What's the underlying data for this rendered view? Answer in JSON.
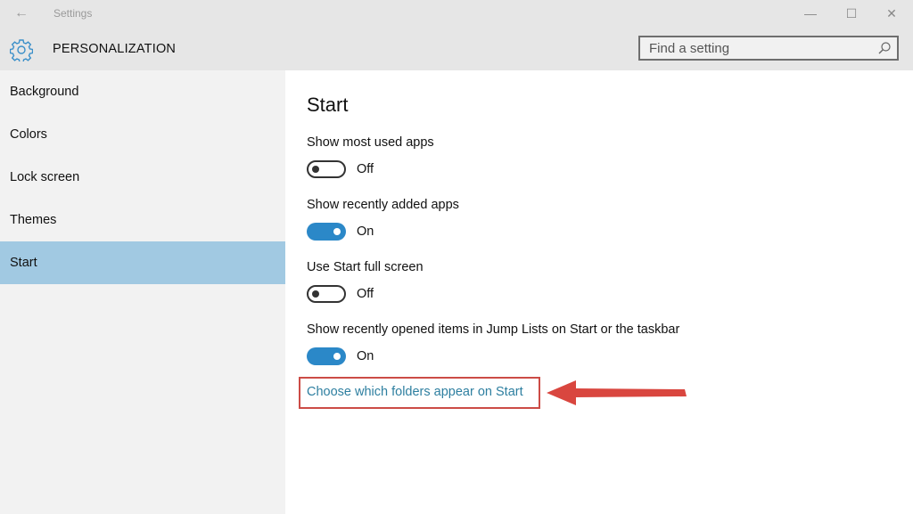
{
  "window": {
    "app_title": "Settings",
    "back_icon": "arrow-left-icon",
    "controls": {
      "minimize": "—",
      "maximize": "☐",
      "close": "✕"
    }
  },
  "header": {
    "icon": "gear-icon",
    "title": "PERSONALIZATION",
    "search": {
      "placeholder": "Find a setting",
      "value": "",
      "icon": "search-icon"
    }
  },
  "sidebar": {
    "items": [
      {
        "label": "Background",
        "active": false
      },
      {
        "label": "Colors",
        "active": false
      },
      {
        "label": "Lock screen",
        "active": false
      },
      {
        "label": "Themes",
        "active": false
      },
      {
        "label": "Start",
        "active": true
      }
    ]
  },
  "main": {
    "heading": "Start",
    "settings": [
      {
        "label": "Show most used apps",
        "state": "Off",
        "on": false
      },
      {
        "label": "Show recently added apps",
        "state": "On",
        "on": true
      },
      {
        "label": "Use Start full screen",
        "state": "Off",
        "on": false
      },
      {
        "label": "Show recently opened items in Jump Lists on Start or the taskbar",
        "state": "On",
        "on": true
      }
    ],
    "link": "Choose which folders appear on Start"
  },
  "colors": {
    "accent": "#2b88c8",
    "selected_nav": "#a1c9e2",
    "link": "#2e7fa0",
    "annotation": "#cc4c46"
  }
}
